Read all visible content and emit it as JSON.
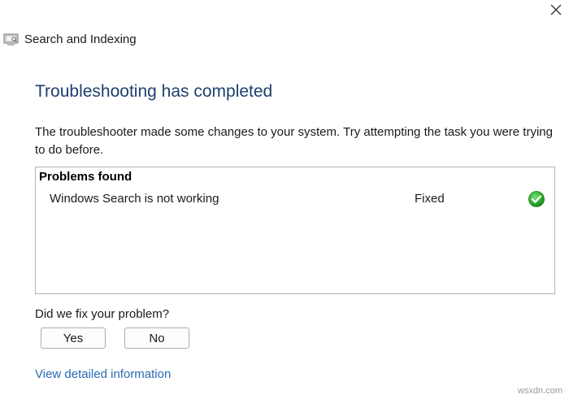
{
  "window": {
    "title": "Search and Indexing",
    "icon": "search-indexing-icon",
    "close_icon": "close-icon"
  },
  "main": {
    "heading": "Troubleshooting has completed",
    "description": "The troubleshooter made some changes to your system. Try attempting the task you were trying to do before."
  },
  "problems": {
    "header": "Problems found",
    "rows": [
      {
        "name": "Windows Search is not working",
        "status": "Fixed",
        "status_icon": "check-icon",
        "status_color": "#2db32d"
      }
    ]
  },
  "feedback": {
    "question": "Did we fix your problem?",
    "yes_label": "Yes",
    "no_label": "No"
  },
  "link": {
    "label": "View detailed information"
  },
  "watermark": "wsxdn.com",
  "colors": {
    "heading": "#1e3f6e",
    "link": "#2a6bb5"
  }
}
